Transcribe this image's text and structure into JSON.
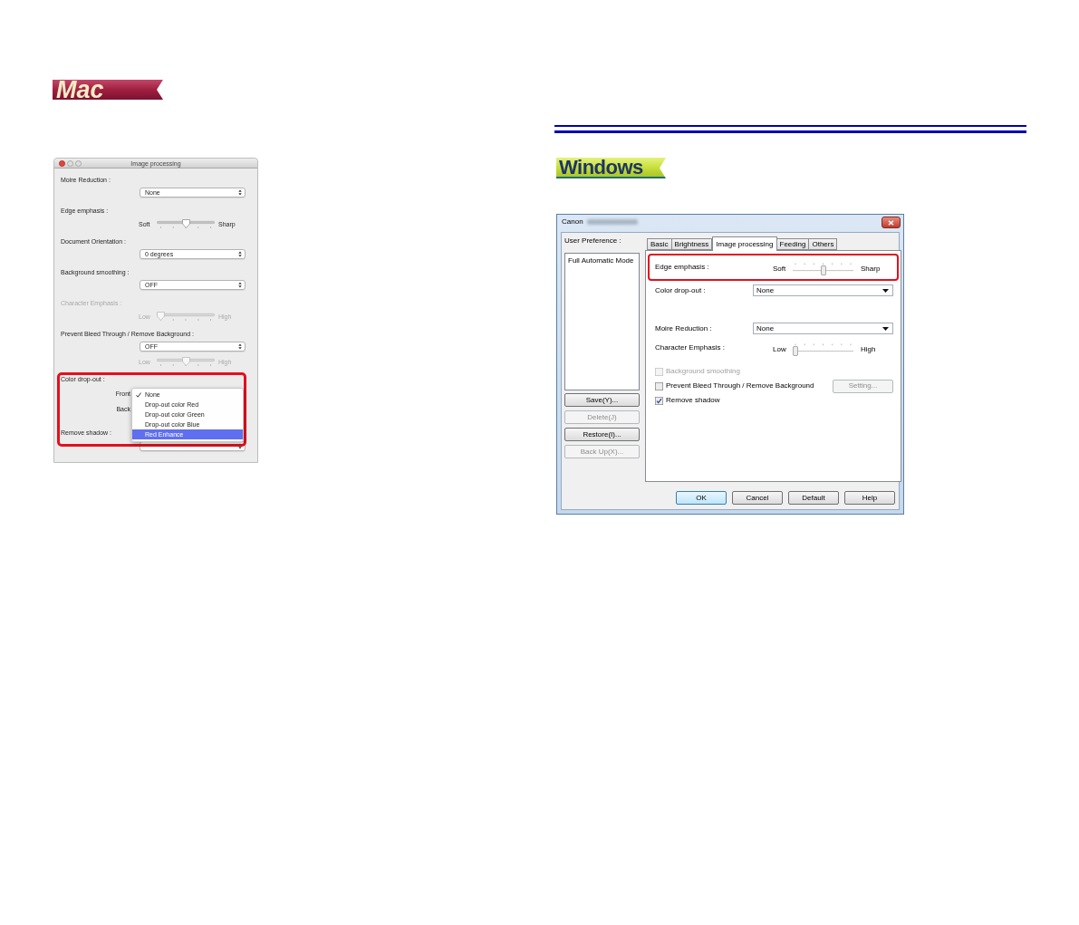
{
  "mac": {
    "badge": "Mac",
    "dialog": {
      "title": "Image processing",
      "settings": [
        {
          "kind": "popup",
          "label": "Moire Reduction :",
          "value": "None",
          "disabled": false
        },
        {
          "kind": "slider",
          "label": "Edge emphasis :",
          "min_label": "Soft",
          "max_label": "Sharp",
          "level": 0.5,
          "disabled": false
        },
        {
          "kind": "popup",
          "label": "Document Orientation :",
          "value": "0 degrees",
          "disabled": false
        },
        {
          "kind": "popup",
          "label": "Background smoothing :",
          "value": "OFF",
          "disabled": false
        },
        {
          "kind": "slider",
          "label": "Character Emphasis :",
          "min_label": "Low",
          "max_label": "High",
          "level": 0,
          "disabled": true
        },
        {
          "kind": "popup",
          "label": "Prevent Bleed Through / Remove Background :",
          "value": "OFF",
          "disabled": false
        },
        {
          "kind": "slider",
          "min_label": "Low",
          "max_label": "High",
          "level": 0.5,
          "disabled": true
        }
      ],
      "color_dropout": {
        "highlighted": true,
        "label": "Color drop-out :",
        "front_label": "Front",
        "back_label": "Back",
        "menu": [
          {
            "label": "None",
            "checked": true,
            "selected": false
          },
          {
            "label": "Drop-out color Red",
            "checked": false,
            "selected": false
          },
          {
            "label": "Drop-out color Green",
            "checked": false,
            "selected": false
          },
          {
            "label": "Drop-out color Blue",
            "checked": false,
            "selected": false
          },
          {
            "label": "Red Enhance",
            "checked": false,
            "selected": true
          }
        ],
        "remove_shadow_label": "Remove shadow :"
      }
    }
  },
  "windows": {
    "badge": "Windows",
    "dialog": {
      "title": "Canon",
      "user_preference": {
        "label": "User Preference :",
        "items": [
          {
            "label": "Full Automatic Mode",
            "selected": false
          }
        ],
        "buttons": [
          {
            "label": "Save(Y)...",
            "disabled": false
          },
          {
            "label": "Delete(J)",
            "disabled": true
          },
          {
            "label": "Restore(I)...",
            "disabled": false
          },
          {
            "label": "Back Up(X)...",
            "disabled": true
          }
        ]
      },
      "tabs": [
        {
          "label": "Basic",
          "selected": false
        },
        {
          "label": "Brightness",
          "selected": false
        },
        {
          "label": "Image processing",
          "selected": true
        },
        {
          "label": "Feeding",
          "selected": false
        },
        {
          "label": "Others",
          "selected": false
        }
      ],
      "settings": [
        {
          "kind": "slider",
          "label": "Edge emphasis :",
          "min_label": "Soft",
          "max_label": "Sharp",
          "level": 0.5,
          "highlighted": true
        },
        {
          "kind": "combo",
          "label": "Color drop-out :",
          "value": "None",
          "highlighted": false
        },
        {
          "kind": "combo",
          "label": "Moire Reduction :",
          "value": "None",
          "highlighted": false
        },
        {
          "kind": "slider",
          "label": "Character Emphasis :",
          "min_label": "Low",
          "max_label": "High",
          "level": 0,
          "highlighted": false
        },
        {
          "kind": "checkbox",
          "label": "Background smoothing",
          "checked": false,
          "disabled": true,
          "highlighted": false
        },
        {
          "kind": "checkbox",
          "label": "Prevent Bleed Through / Remove Background",
          "checked": false,
          "disabled": false,
          "highlighted": false,
          "button": {
            "label": "Setting...",
            "disabled": true
          }
        },
        {
          "kind": "checkbox",
          "label": "Remove shadow",
          "checked": true,
          "disabled": false,
          "highlighted": false
        }
      ],
      "buttons": [
        {
          "label": "OK",
          "default": true
        },
        {
          "label": "Cancel",
          "default": false
        },
        {
          "label": "Default",
          "default": false
        },
        {
          "label": "Help",
          "default": false
        }
      ]
    }
  }
}
